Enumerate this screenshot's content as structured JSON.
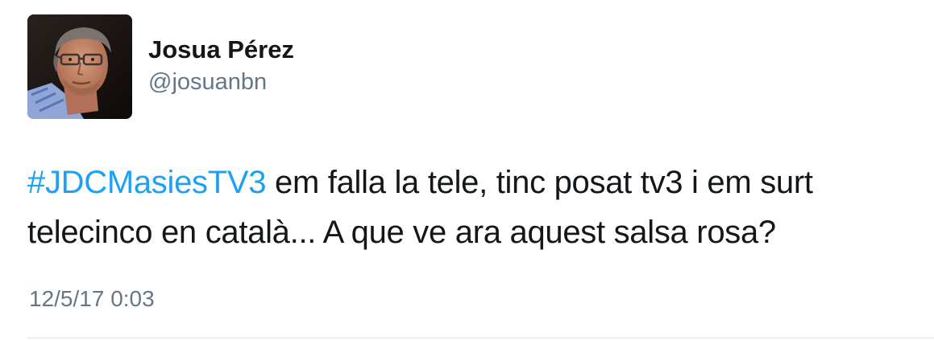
{
  "tweet": {
    "author": {
      "display_name": "Josua Pérez",
      "handle": "@josuanbn",
      "avatar_icon": "profile-photo"
    },
    "hashtag": "#JDCMasiesTV3",
    "text_line1": " em falla la tele, tinc posat tv3 i em surt",
    "text_line2": "telecinco en català... A que ve ara aquest salsa rosa?",
    "timestamp": "12/5/17 0:03"
  },
  "colors": {
    "hashtag": "#1da1f2",
    "secondary_text": "#657786",
    "primary_text": "#14171a",
    "divider": "#e1e8ed"
  }
}
